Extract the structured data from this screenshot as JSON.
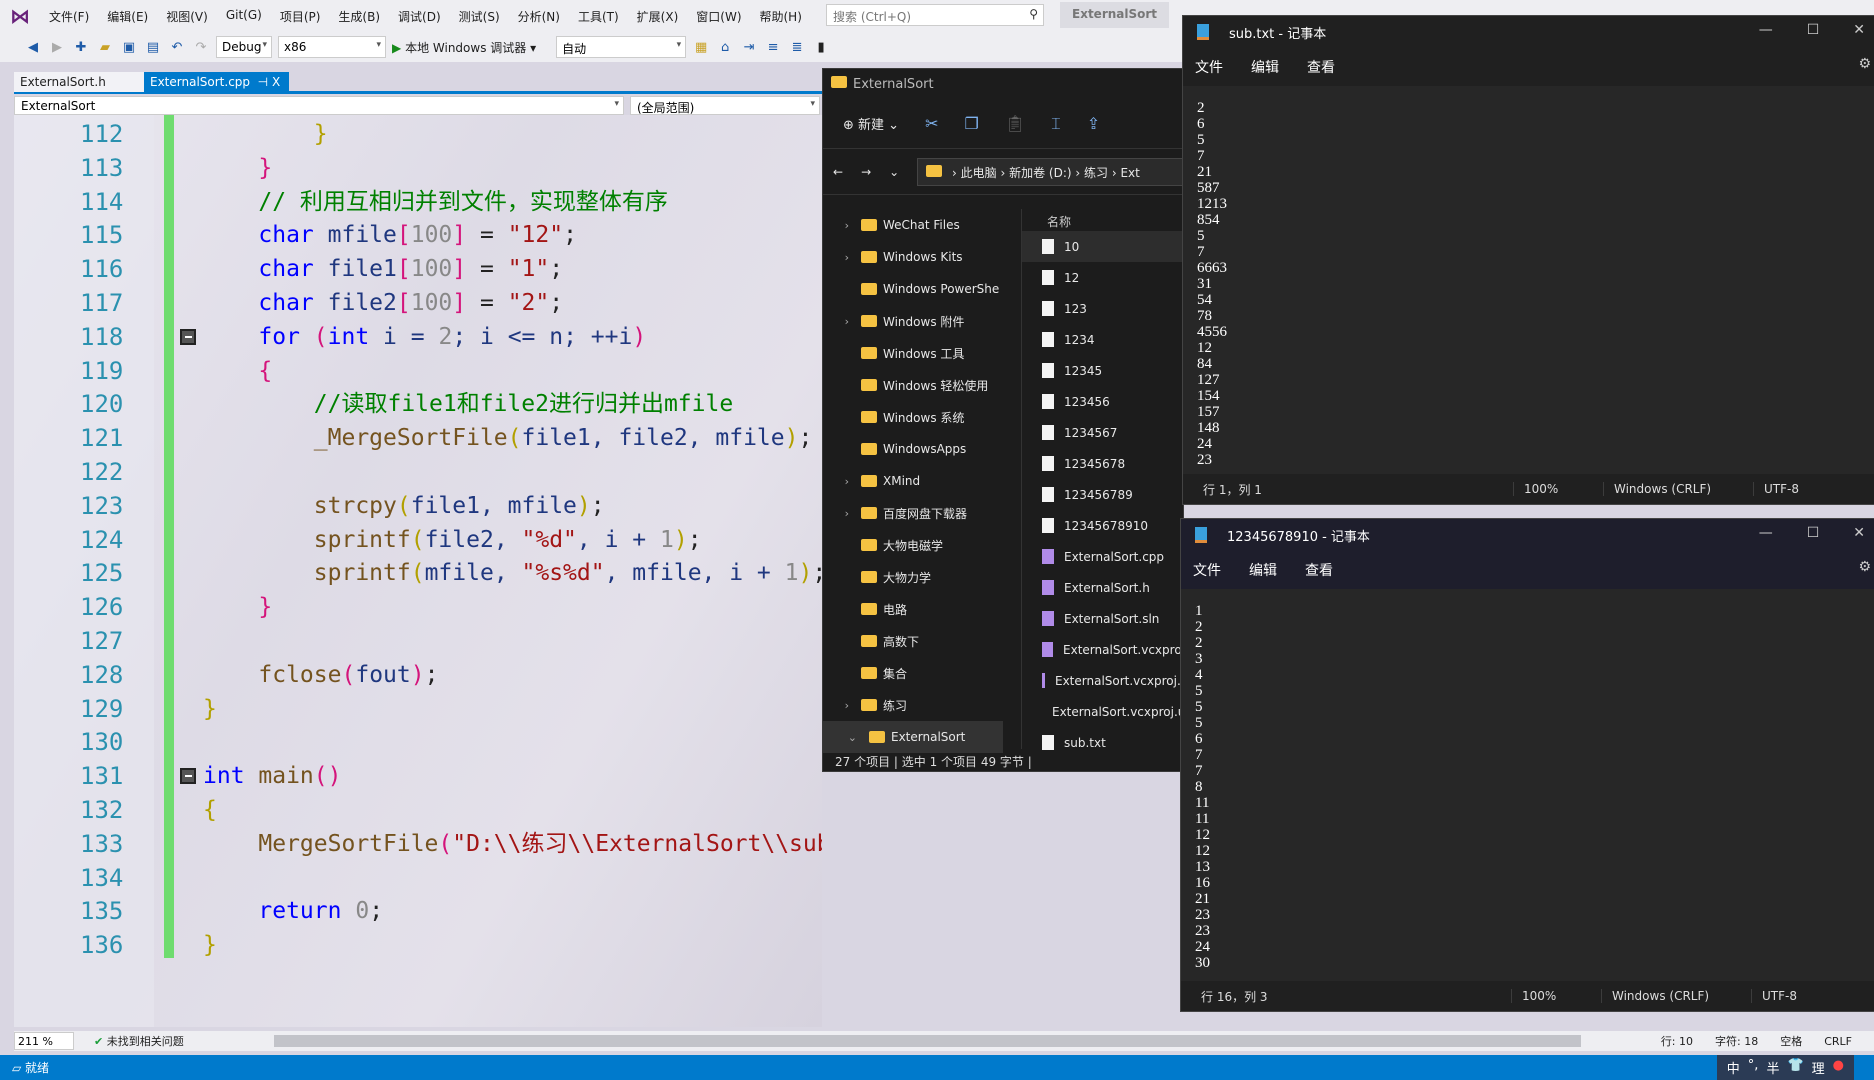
{
  "vs": {
    "menu": [
      "文件(F)",
      "编辑(E)",
      "视图(V)",
      "Git(G)",
      "项目(P)",
      "生成(B)",
      "调试(D)",
      "测试(S)",
      "分析(N)",
      "工具(T)",
      "扩展(X)",
      "窗口(W)",
      "帮助(H)"
    ],
    "search_placeholder": "搜索 (Ctrl+Q)",
    "solution_name": "ExternalSort",
    "toolbar": {
      "config": "Debug",
      "platform": "x86",
      "run_label": "本地 Windows 调试器",
      "auto": "自动"
    },
    "tabs": [
      {
        "label": "ExternalSort.h",
        "active": false
      },
      {
        "label": "ExternalSort.cpp",
        "active": true
      }
    ],
    "tab_pin": "⊣",
    "tab_close": "X",
    "nav": {
      "scope": "ExternalSort",
      "member": "(全局范围)"
    },
    "code": [
      {
        "n": "112",
        "t": [
          [
            "        ",
            ""
          ],
          [
            "}",
            "p2"
          ]
        ]
      },
      {
        "n": "113",
        "t": [
          [
            "    ",
            ""
          ],
          [
            "}",
            "p1"
          ]
        ]
      },
      {
        "n": "114",
        "t": [
          [
            "    ",
            ""
          ],
          [
            "// 利用互相归并到文件，实现整体有序",
            "cm"
          ]
        ]
      },
      {
        "n": "115",
        "t": [
          [
            "    ",
            ""
          ],
          [
            "char",
            "kw"
          ],
          [
            " mfile",
            "id"
          ],
          [
            "[",
            "p1"
          ],
          [
            "100",
            "num"
          ],
          [
            "]",
            "p1"
          ],
          [
            " = ",
            "op"
          ],
          [
            "\"12\"",
            "str"
          ],
          [
            ";",
            "op"
          ]
        ]
      },
      {
        "n": "116",
        "t": [
          [
            "    ",
            ""
          ],
          [
            "char",
            "kw"
          ],
          [
            " file1",
            "id"
          ],
          [
            "[",
            "p1"
          ],
          [
            "100",
            "num"
          ],
          [
            "]",
            "p1"
          ],
          [
            " = ",
            "op"
          ],
          [
            "\"1\"",
            "str"
          ],
          [
            ";",
            "op"
          ]
        ]
      },
      {
        "n": "117",
        "t": [
          [
            "    ",
            ""
          ],
          [
            "char",
            "kw"
          ],
          [
            " file2",
            "id"
          ],
          [
            "[",
            "p1"
          ],
          [
            "100",
            "num"
          ],
          [
            "]",
            "p1"
          ],
          [
            " = ",
            "op"
          ],
          [
            "\"2\"",
            "str"
          ],
          [
            ";",
            "op"
          ]
        ]
      },
      {
        "n": "118",
        "fold": true,
        "t": [
          [
            "    ",
            ""
          ],
          [
            "for",
            "kw"
          ],
          [
            " ",
            ""
          ],
          [
            "(",
            "p1"
          ],
          [
            "int",
            "kw"
          ],
          [
            " i = ",
            "id"
          ],
          [
            "2",
            "num"
          ],
          [
            "; i <= n; ++i",
            "id"
          ],
          [
            ")",
            "p1"
          ]
        ]
      },
      {
        "n": "119",
        "t": [
          [
            "    ",
            ""
          ],
          [
            "{",
            "p1"
          ]
        ]
      },
      {
        "n": "120",
        "t": [
          [
            "        ",
            ""
          ],
          [
            "//读取file1和file2进行归并出mfile",
            "cm"
          ]
        ]
      },
      {
        "n": "121",
        "t": [
          [
            "        ",
            ""
          ],
          [
            "_MergeSortFile",
            "fn"
          ],
          [
            "(",
            "p2"
          ],
          [
            "file1, file2, mfile",
            "id"
          ],
          [
            ")",
            "p2"
          ],
          [
            ";",
            "op"
          ]
        ]
      },
      {
        "n": "122",
        "t": []
      },
      {
        "n": "123",
        "t": [
          [
            "        ",
            ""
          ],
          [
            "strcpy",
            "fn"
          ],
          [
            "(",
            "p2"
          ],
          [
            "file1, mfile",
            "id"
          ],
          [
            ")",
            "p2"
          ],
          [
            ";",
            "op"
          ]
        ]
      },
      {
        "n": "124",
        "t": [
          [
            "        ",
            ""
          ],
          [
            "sprintf",
            "fn"
          ],
          [
            "(",
            "p2"
          ],
          [
            "file2, ",
            "id"
          ],
          [
            "\"%d\"",
            "str"
          ],
          [
            ", i + ",
            "id"
          ],
          [
            "1",
            "num"
          ],
          [
            ")",
            "p2"
          ],
          [
            ";",
            "op"
          ]
        ]
      },
      {
        "n": "125",
        "t": [
          [
            "        ",
            ""
          ],
          [
            "sprintf",
            "fn"
          ],
          [
            "(",
            "p2"
          ],
          [
            "mfile, ",
            "id"
          ],
          [
            "\"%s%d\"",
            "str"
          ],
          [
            ", mfile, i + ",
            "id"
          ],
          [
            "1",
            "num"
          ],
          [
            ")",
            "p2"
          ],
          [
            ";",
            "op"
          ]
        ]
      },
      {
        "n": "126",
        "t": [
          [
            "    ",
            ""
          ],
          [
            "}",
            "p1"
          ]
        ]
      },
      {
        "n": "127",
        "t": []
      },
      {
        "n": "128",
        "t": [
          [
            "    ",
            ""
          ],
          [
            "fclose",
            "fn"
          ],
          [
            "(",
            "p1"
          ],
          [
            "fout",
            "id"
          ],
          [
            ")",
            "p1"
          ],
          [
            ";",
            "op"
          ]
        ]
      },
      {
        "n": "129",
        "t": [
          [
            "}",
            "p2"
          ]
        ]
      },
      {
        "n": "130",
        "t": []
      },
      {
        "n": "131",
        "fold": true,
        "t": [
          [
            "int",
            "kw"
          ],
          [
            " main",
            "fn"
          ],
          [
            "()",
            "p1"
          ]
        ]
      },
      {
        "n": "132",
        "t": [
          [
            "{",
            "p2"
          ]
        ]
      },
      {
        "n": "133",
        "t": [
          [
            "    ",
            ""
          ],
          [
            "MergeSortFile",
            "fn"
          ],
          [
            "(",
            "p1"
          ],
          [
            "\"D:\\\\练习\\\\ExternalSort\\\\sub.txt\"",
            "str"
          ],
          [
            ")",
            "p1"
          ],
          [
            ";",
            "op"
          ]
        ]
      },
      {
        "n": "134",
        "t": []
      },
      {
        "n": "135",
        "t": [
          [
            "    ",
            ""
          ],
          [
            "return",
            "kw"
          ],
          [
            " ",
            ""
          ],
          [
            "0",
            "num"
          ],
          [
            ";",
            "op"
          ]
        ]
      },
      {
        "n": "136",
        "t": [
          [
            "}",
            "p2"
          ]
        ]
      }
    ],
    "zoom": "211 %",
    "issues": "未找到相关问题",
    "line": "行: 10",
    "char": "字符: 18",
    "space": "空格",
    "eol": "CRLF",
    "status": "就绪",
    "tray": [
      "中",
      "°,",
      "半",
      "👕",
      "理"
    ]
  },
  "explorer": {
    "title": "ExternalSort",
    "new_label": "新建",
    "breadcrumbs": [
      "此电脑",
      "新加卷 (D:)",
      "练习",
      "Ext"
    ],
    "tree": [
      {
        "label": "WeChat Files",
        "exp": true
      },
      {
        "label": "Windows Kits",
        "exp": true
      },
      {
        "label": "Windows PowerShe",
        "exp": false
      },
      {
        "label": "Windows 附件",
        "exp": true
      },
      {
        "label": "Windows 工具",
        "exp": false
      },
      {
        "label": "Windows 轻松使用",
        "exp": false
      },
      {
        "label": "Windows 系统",
        "exp": false
      },
      {
        "label": "WindowsApps",
        "exp": false
      },
      {
        "label": "XMind",
        "exp": true
      },
      {
        "label": "百度网盘下载器",
        "exp": true
      },
      {
        "label": "大物电磁学",
        "exp": false
      },
      {
        "label": "大物力学",
        "exp": false
      },
      {
        "label": "电路",
        "exp": false
      },
      {
        "label": "高数下",
        "exp": false
      },
      {
        "label": "集合",
        "exp": false
      },
      {
        "label": "练习",
        "exp": true
      },
      {
        "label": "ExternalSort",
        "exp": "open",
        "selected": true
      }
    ],
    "column_name": "名称",
    "files": [
      {
        "name": "10",
        "selected": true
      },
      {
        "name": "12"
      },
      {
        "name": "123"
      },
      {
        "name": "1234"
      },
      {
        "name": "12345"
      },
      {
        "name": "123456"
      },
      {
        "name": "1234567"
      },
      {
        "name": "12345678"
      },
      {
        "name": "123456789"
      },
      {
        "name": "12345678910"
      },
      {
        "name": "ExternalSort.cpp",
        "vs": true
      },
      {
        "name": "ExternalSort.h",
        "vs": true
      },
      {
        "name": "ExternalSort.sln",
        "vs": true
      },
      {
        "name": "ExternalSort.vcxproj",
        "vs": true
      },
      {
        "name": "ExternalSort.vcxproj.f",
        "vs": true
      },
      {
        "name": "ExternalSort.vcxproj.u",
        "vs": true
      },
      {
        "name": "sub.txt"
      }
    ],
    "status": "27 个项目  |  选中 1 个项目  49 字节  |"
  },
  "notepad1": {
    "title": "sub.txt - 记事本",
    "menu": [
      "文件",
      "编辑",
      "查看"
    ],
    "content": "2\n6\n5\n7\n21\n587\n1213\n854\n5\n7\n6663\n31\n54\n78\n4556\n12\n84\n127\n154\n157\n148\n24\n23",
    "pos": "行 1，列 1",
    "zoom": "100%",
    "eol": "Windows (CRLF)",
    "enc": "UTF-8"
  },
  "notepad2": {
    "title": "12345678910 - 记事本",
    "menu": [
      "文件",
      "编辑",
      "查看"
    ],
    "content": "1\n2\n2\n3\n4\n5\n5\n5\n6\n7\n7\n8\n11\n11\n12\n12\n13\n16\n21\n23\n23\n24\n30",
    "pos": "行 16，列 3",
    "zoom": "100%",
    "eol": "Windows (CRLF)",
    "enc": "UTF-8"
  }
}
